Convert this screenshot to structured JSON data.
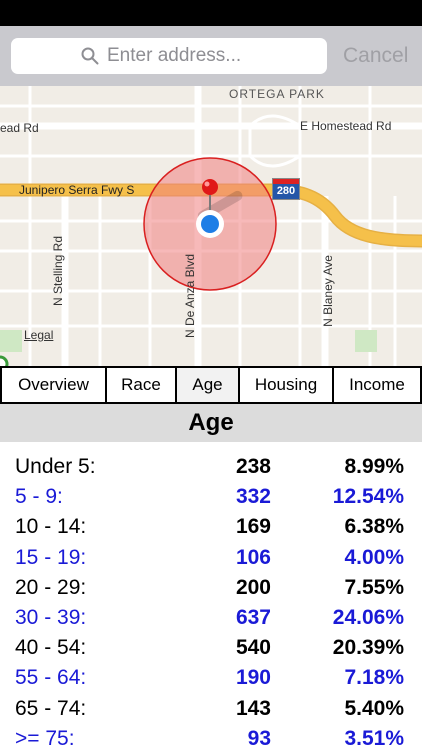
{
  "search": {
    "placeholder": "Enter address...",
    "cancel_label": "Cancel"
  },
  "map": {
    "labels": {
      "park": "ORTEGA PARK",
      "homestead_west": "ead Rd",
      "homestead_east": "E Homestead Rd",
      "freeway": "Junipero Serra Fwy S",
      "shield": "280",
      "stelling": "N Stelling Rd",
      "deanza": "N De Anza Blvd",
      "blaney": "N Blaney Ave",
      "legal": "Legal"
    }
  },
  "tabs": [
    {
      "label": "Overview"
    },
    {
      "label": "Race"
    },
    {
      "label": "Age"
    },
    {
      "label": "Housing"
    },
    {
      "label": "Income"
    }
  ],
  "section": {
    "title": "Age"
  },
  "rows": [
    {
      "label": "Under 5:",
      "count": "238",
      "percent": "8.99%"
    },
    {
      "label": "5 - 9:",
      "count": "332",
      "percent": "12.54%"
    },
    {
      "label": "10 - 14:",
      "count": "169",
      "percent": "6.38%"
    },
    {
      "label": "15 - 19:",
      "count": "106",
      "percent": "4.00%"
    },
    {
      "label": "20 - 29:",
      "count": "200",
      "percent": "7.55%"
    },
    {
      "label": "30 - 39:",
      "count": "637",
      "percent": "24.06%"
    },
    {
      "label": "40 - 54:",
      "count": "540",
      "percent": "20.39%"
    },
    {
      "label": "55 - 64:",
      "count": "190",
      "percent": "7.18%"
    },
    {
      "label": "65 - 74:",
      "count": "143",
      "percent": "5.40%"
    },
    {
      "label": ">= 75:",
      "count": "93",
      "percent": "3.51%"
    }
  ],
  "colors": {
    "text": "#000000",
    "alt_text": "#1a1ad6",
    "radius_fill": "#f08080",
    "freeway": "#f5c04a"
  }
}
